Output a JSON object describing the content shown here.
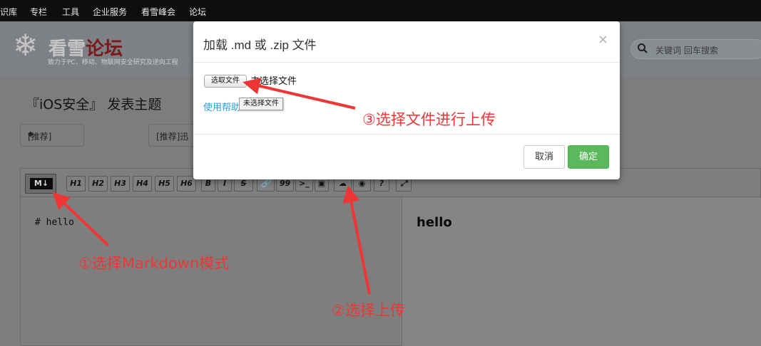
{
  "topnav": {
    "items": [
      "识库",
      "专栏",
      "工具",
      "企业服务",
      "看雪峰会",
      "论坛"
    ]
  },
  "header": {
    "logo_icon": "snowflake-icon",
    "logo_text_a": "看雪",
    "logo_text_b": "论坛",
    "logo_subtitle": "致力于PC、移动、物联网安全研究及逆向工程",
    "search_placeholder": "关键词 回车搜索"
  },
  "page": {
    "title": "『iOS安全』 发表主题",
    "select_type": "[推荐]",
    "select_thread": "[推荐]迅"
  },
  "editor": {
    "mode_button": "M↓",
    "toolbar": [
      "H1",
      "H2",
      "H3",
      "H4",
      "H5",
      "H6",
      "B",
      "I",
      "S",
      "🔗",
      "99",
      ">_",
      "▣",
      "☁",
      "◉",
      "?",
      "⤢"
    ],
    "source_text": "# hello",
    "preview_text": "hello"
  },
  "modal": {
    "title": "加载 .md 或 .zip 文件",
    "close": "×",
    "choose_file": "选取文件",
    "file_status": "未选择文件",
    "help_link": "使用帮助",
    "tooltip": "未选择文件",
    "cancel": "取消",
    "ok": "确定"
  },
  "annotations": {
    "step1": "①选择Markdown模式",
    "step2": "②选择上传",
    "step3": "③选择文件进行上传"
  },
  "colors": {
    "annotation": "#ee3636",
    "ok_button": "#5cb85c",
    "link": "#2a9fd6"
  }
}
